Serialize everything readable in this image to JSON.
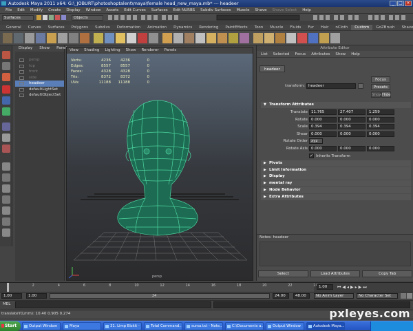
{
  "window": {
    "title": "Autodesk Maya 2011 x64: G:\\_JOBURT\\photoshoptalent\\maya\\female head_new_maya.mb* --- headeer"
  },
  "menubar": [
    "File",
    "Edit",
    "Modify",
    "Create",
    "Display",
    "Window",
    "Assets",
    "Edit Curves",
    "Surfaces",
    "Edit NURBS",
    "Subdiv Surfaces",
    "Muscle",
    "Shave",
    "Shave Select",
    "Help"
  ],
  "statusline": {
    "mode": "Surfaces",
    "select_mode": "Objects"
  },
  "shelf_tabs": [
    "General",
    "Curves",
    "Surfaces",
    "Polygons",
    "Subdivs",
    "Deformation",
    "Animation",
    "Dynamics",
    "Rendering",
    "PaintEffects",
    "Toon",
    "Muscle",
    "Fluids",
    "Fur",
    "Hair",
    "nCloth",
    "Custom",
    "GoZBrush",
    "Shave"
  ],
  "shelf_active": "Custom",
  "outliner": {
    "menu": [
      "Display",
      "Show",
      "Panels"
    ],
    "items": [
      {
        "label": "persp",
        "state": "dim"
      },
      {
        "label": "top",
        "state": "dim"
      },
      {
        "label": "front",
        "state": "dim"
      },
      {
        "label": "side",
        "state": "dim"
      },
      {
        "label": "headeer",
        "state": "selected"
      },
      {
        "label": "defaultLightSet",
        "state": "on"
      },
      {
        "label": "defaultObjectSet",
        "state": "on"
      }
    ]
  },
  "viewport": {
    "menu": [
      "View",
      "Shading",
      "Lighting",
      "Show",
      "Renderer",
      "Panels"
    ],
    "hud": [
      {
        "label": "Verts:",
        "a": "4236",
        "b": "4236",
        "c": "0"
      },
      {
        "label": "Edges:",
        "a": "8557",
        "b": "8557",
        "c": "0"
      },
      {
        "label": "Faces:",
        "a": "4328",
        "b": "4328",
        "c": "0"
      },
      {
        "label": "Tris:",
        "a": "8372",
        "b": "8372",
        "c": "0"
      },
      {
        "label": "UVs:",
        "a": "11188",
        "b": "11188",
        "c": "0"
      }
    ],
    "camera": "persp"
  },
  "attribute_editor": {
    "title": "Attribute Editor",
    "menu": [
      "List",
      "Selected",
      "Focus",
      "Attributes",
      "Show",
      "Help"
    ],
    "node_tab": "headeer",
    "transform_label": "transform:",
    "transform_value": "headeer",
    "focus_btn": "Focus",
    "presets_btn": "Presets",
    "show_btn": "Show",
    "hide_btn": "Hide",
    "section_transform": "Transform Attributes",
    "rows": [
      {
        "label": "Translate",
        "x": "11.765",
        "y": "27.407",
        "z": "1.259"
      },
      {
        "label": "Rotate",
        "x": "0.000",
        "y": "0.000",
        "z": "0.000"
      },
      {
        "label": "Scale",
        "x": "0.394",
        "y": "0.394",
        "z": "0.394"
      },
      {
        "label": "Shear",
        "x": "0.000",
        "y": "0.000",
        "z": "0.000"
      }
    ],
    "rotate_order_label": "Rotate Order",
    "rotate_order": "xyz",
    "rotate_axis_label": "Rotate Axis",
    "rotate_axis": [
      "0.000",
      "0.000",
      "0.000"
    ],
    "inherits_label": "Inherits Transform",
    "collapsed_sections": [
      "Pivots",
      "Limit Information",
      "Display",
      "mental ray",
      "Node Behavior",
      "Extra Attributes"
    ],
    "notes_label": "Notes: headeer",
    "buttons": [
      "Select",
      "Load Attributes",
      "Copy Tab"
    ]
  },
  "timeline": {
    "ticks": [
      "2",
      "4",
      "6",
      "8",
      "10",
      "12",
      "14",
      "16",
      "18",
      "20",
      "22",
      "24"
    ],
    "current_frame": "1.00"
  },
  "range": {
    "start": "1.00",
    "playback_start": "1.00",
    "playback_end": "24.00",
    "end": "48.00",
    "slider_value": "24",
    "anim_layer": "No Anim Layer",
    "char_set": "No Character Set"
  },
  "mel_label": "MEL",
  "help_line": "translateY(Lmm):   10.40   0.905   0.274",
  "taskbar": {
    "start": "Start",
    "tasks": [
      "Output Window",
      "Maya",
      "31. Limp Bizkit - ...",
      "Total Command...",
      "sursa.txt - Note...",
      "C:\\Documents a...",
      "Output Window",
      "Autodesk Maya..."
    ],
    "active_task": 7
  },
  "watermark": "pxleyes.com"
}
